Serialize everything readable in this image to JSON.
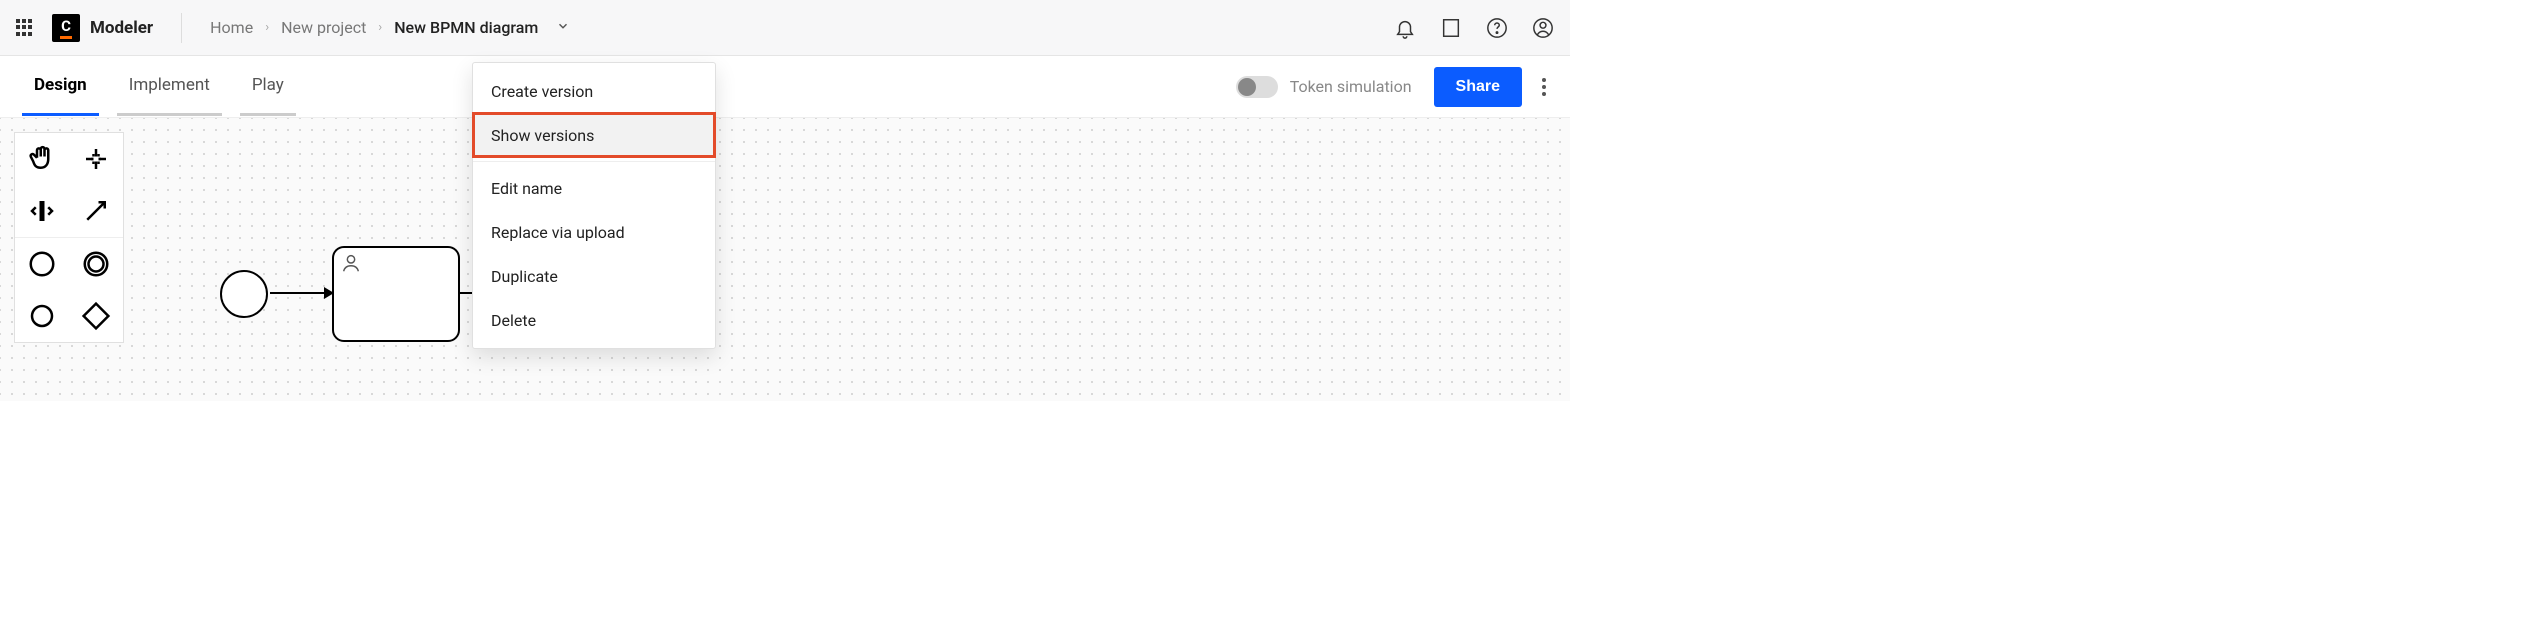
{
  "header": {
    "app_name": "Modeler",
    "logo_letter": "C",
    "breadcrumbs": [
      "Home",
      "New project",
      "New BPMN diagram"
    ]
  },
  "tabs": {
    "items": [
      "Design",
      "Implement",
      "Play"
    ],
    "active_index": 0,
    "toggle_label": "Token simulation",
    "share_label": "Share"
  },
  "dropdown": {
    "items": [
      "Create version",
      "Show versions",
      "Edit name",
      "Replace via upload",
      "Duplicate",
      "Delete"
    ],
    "highlighted_index": 1
  },
  "palette": {
    "tools": [
      "hand-tool",
      "lasso-tool",
      "space-tool",
      "global-connect-tool",
      "start-event-tool",
      "intermediate-event-tool",
      "end-event-tool",
      "gateway-tool"
    ]
  }
}
